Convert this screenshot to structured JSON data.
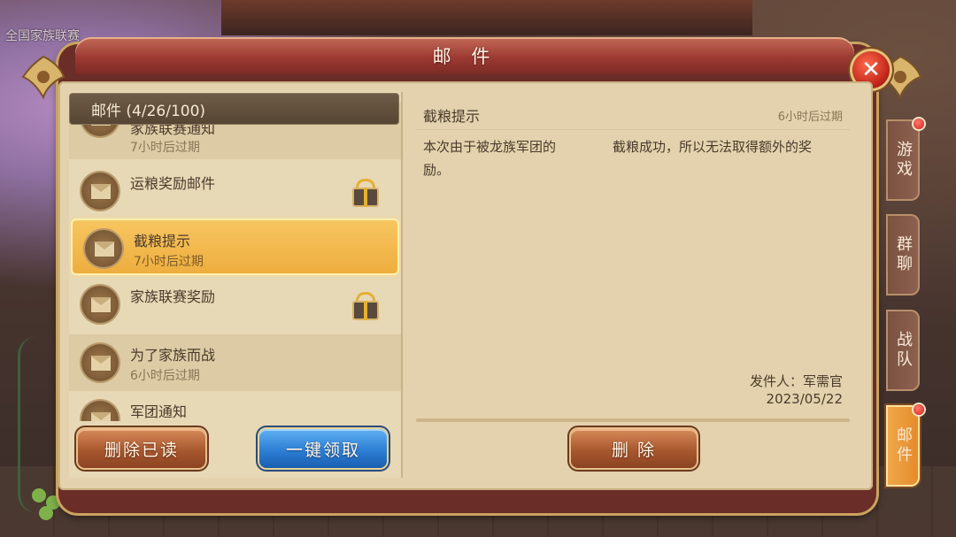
{
  "background": {
    "news_ticker": "全国家族联赛"
  },
  "window": {
    "title": "邮 件",
    "close_icon": "close-icon"
  },
  "mailbox": {
    "header": "邮件 (4/26/100)",
    "items": [
      {
        "title": "家族联赛通知",
        "subtitle": "7小时后过期",
        "has_attachment": false,
        "selected": false,
        "partial": true
      },
      {
        "title": "运粮奖励邮件",
        "subtitle": "",
        "has_attachment": true,
        "selected": false
      },
      {
        "title": "截粮提示",
        "subtitle": "7小时后过期",
        "has_attachment": false,
        "selected": true
      },
      {
        "title": "家族联赛奖励",
        "subtitle": "",
        "has_attachment": true,
        "selected": false
      },
      {
        "title": "为了家族而战",
        "subtitle": "6小时后过期",
        "has_attachment": false,
        "selected": false
      },
      {
        "title": "军团通知",
        "subtitle": "",
        "has_attachment": false,
        "selected": false,
        "partial": true
      }
    ],
    "delete_read_label": "删除已读",
    "claim_all_label": "一键领取"
  },
  "detail": {
    "subject": "截粮提示",
    "expire": "6小时后过期",
    "body_part1": "本次由于被龙族军团的",
    "body_part2": "截粮成功，所以无法取得额外的奖",
    "body_part3": "励。",
    "sender": "发件人：军需官",
    "date": "2023/05/22",
    "delete_label": "删 除"
  },
  "side_tabs": [
    {
      "label": "游戏",
      "badge": true,
      "active": false
    },
    {
      "label": "群聊",
      "badge": false,
      "active": false
    },
    {
      "label": "战队",
      "badge": false,
      "active": false
    },
    {
      "label": "邮件",
      "badge": true,
      "active": true
    }
  ],
  "colors": {
    "selected_row": "#eeae3e",
    "blue_button": "#2d7fd4",
    "brown_button": "#a9582f",
    "badge_red": "#d3231c"
  }
}
